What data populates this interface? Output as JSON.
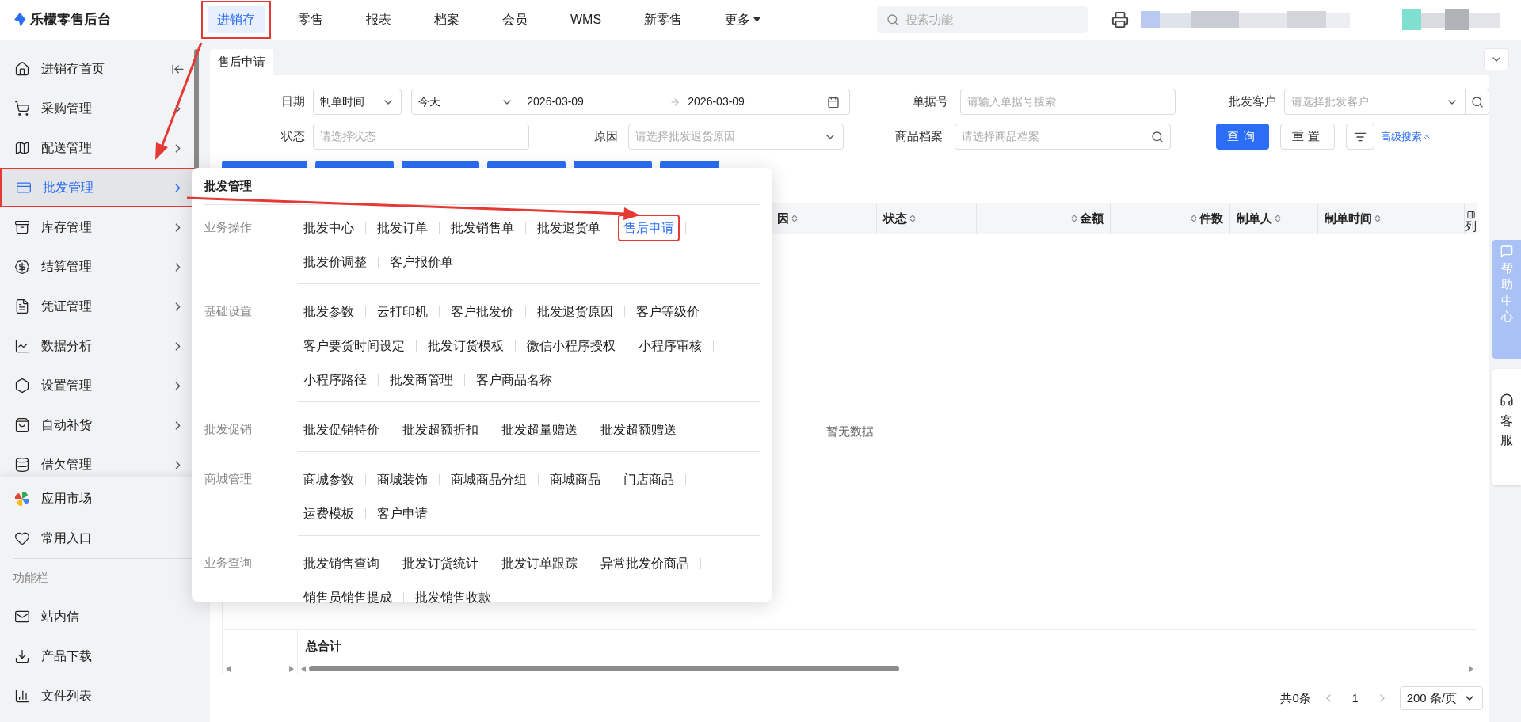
{
  "app": {
    "name": "乐檬零售后台"
  },
  "top_nav": [
    {
      "label": "进销存",
      "selected": true,
      "highlighted": true,
      "kind": "link"
    },
    {
      "label": "零售",
      "selected": false,
      "highlighted": false,
      "kind": "link"
    },
    {
      "label": "报表",
      "selected": false,
      "highlighted": false,
      "kind": "link"
    },
    {
      "label": "档案",
      "selected": false,
      "highlighted": false,
      "kind": "link"
    },
    {
      "label": "会员",
      "selected": false,
      "highlighted": false,
      "kind": "link"
    },
    {
      "label": "WMS",
      "selected": false,
      "highlighted": false,
      "kind": "link"
    },
    {
      "label": "新零售",
      "selected": false,
      "highlighted": false,
      "kind": "link"
    },
    {
      "label": "更多",
      "selected": false,
      "highlighted": false,
      "kind": "dropdown"
    }
  ],
  "search": {
    "placeholder": "搜索功能"
  },
  "sidebar": {
    "items": [
      {
        "label": "进销存首页",
        "kind": "home",
        "selected": false,
        "highlighted": false
      },
      {
        "label": "采购管理",
        "kind": "group",
        "selected": false,
        "highlighted": false
      },
      {
        "label": "配送管理",
        "kind": "group",
        "selected": false,
        "highlighted": false
      },
      {
        "label": "批发管理",
        "kind": "group",
        "selected": true,
        "highlighted": true
      },
      {
        "label": "库存管理",
        "kind": "group",
        "selected": false,
        "highlighted": false
      },
      {
        "label": "结算管理",
        "kind": "group",
        "selected": false,
        "highlighted": false
      },
      {
        "label": "凭证管理",
        "kind": "group",
        "selected": false,
        "highlighted": false
      },
      {
        "label": "数据分析",
        "kind": "group",
        "selected": false,
        "highlighted": false
      },
      {
        "label": "设置管理",
        "kind": "group",
        "selected": false,
        "highlighted": false
      },
      {
        "label": "自动补货",
        "kind": "group",
        "selected": false,
        "highlighted": false
      },
      {
        "label": "借欠管理",
        "kind": "group",
        "selected": false,
        "highlighted": false
      }
    ],
    "quick": [
      {
        "label": "应用市场"
      },
      {
        "label": "常用入口"
      }
    ],
    "section_title": "功能栏",
    "tools": [
      {
        "label": "站内信"
      },
      {
        "label": "产品下载"
      },
      {
        "label": "文件列表"
      }
    ]
  },
  "tabs": [
    {
      "label": "售后申请",
      "selected": true
    }
  ],
  "filters": {
    "date": {
      "label": "日期",
      "field": "制单时间",
      "preset": "今天",
      "start": "2026-03-09",
      "end": "2026-03-09"
    },
    "doc_no": {
      "label": "单据号",
      "placeholder": "请输入单据号搜索"
    },
    "customer": {
      "label": "批发客户",
      "placeholder": "请选择批发客户"
    },
    "status": {
      "label": "状态",
      "placeholder": "请选择状态"
    },
    "reason": {
      "label": "原因",
      "placeholder": "请选择批发退货原因"
    },
    "product": {
      "label": "商品档案",
      "placeholder": "请选择商品档案"
    },
    "buttons": [
      {
        "label": "查询",
        "kind": "primary"
      },
      {
        "label": "重置",
        "kind": "default"
      }
    ],
    "advanced_link": "高级搜索"
  },
  "popup": {
    "title": "批发管理",
    "sections": [
      {
        "label": "业务操作",
        "items": [
          {
            "label": "批发中心",
            "selected": false,
            "highlighted": false
          },
          {
            "label": "批发订单",
            "selected": false,
            "highlighted": false
          },
          {
            "label": "批发销售单",
            "selected": false,
            "highlighted": false
          },
          {
            "label": "批发退货单",
            "selected": false,
            "highlighted": false
          },
          {
            "label": "售后申请",
            "selected": true,
            "highlighted": true
          },
          {
            "label": "批发价调整",
            "selected": false,
            "highlighted": false
          },
          {
            "label": "客户报价单",
            "selected": false,
            "highlighted": false
          }
        ]
      },
      {
        "label": "基础设置",
        "items": [
          {
            "label": "批发参数",
            "selected": false,
            "highlighted": false
          },
          {
            "label": "云打印机",
            "selected": false,
            "highlighted": false
          },
          {
            "label": "客户批发价",
            "selected": false,
            "highlighted": false
          },
          {
            "label": "批发退货原因",
            "selected": false,
            "highlighted": false
          },
          {
            "label": "客户等级价",
            "selected": false,
            "highlighted": false
          },
          {
            "label": "客户要货时间设定",
            "selected": false,
            "highlighted": false
          },
          {
            "label": "批发订货模板",
            "selected": false,
            "highlighted": false
          },
          {
            "label": "微信小程序授权",
            "selected": false,
            "highlighted": false
          },
          {
            "label": "小程序审核",
            "selected": false,
            "highlighted": false
          },
          {
            "label": "小程序路径",
            "selected": false,
            "highlighted": false
          },
          {
            "label": "批发商管理",
            "selected": false,
            "highlighted": false
          },
          {
            "label": "客户商品名称",
            "selected": false,
            "highlighted": false
          }
        ]
      },
      {
        "label": "批发促销",
        "items": [
          {
            "label": "批发促销特价",
            "selected": false,
            "highlighted": false
          },
          {
            "label": "批发超额折扣",
            "selected": false,
            "highlighted": false
          },
          {
            "label": "批发超量赠送",
            "selected": false,
            "highlighted": false
          },
          {
            "label": "批发超额赠送",
            "selected": false,
            "highlighted": false
          }
        ]
      },
      {
        "label": "商城管理",
        "items": [
          {
            "label": "商城参数",
            "selected": false,
            "highlighted": false
          },
          {
            "label": "商城装饰",
            "selected": false,
            "highlighted": false
          },
          {
            "label": "商城商品分组",
            "selected": false,
            "highlighted": false
          },
          {
            "label": "商城商品",
            "selected": false,
            "highlighted": false
          },
          {
            "label": "门店商品",
            "selected": false,
            "highlighted": false
          },
          {
            "label": "运费模板",
            "selected": false,
            "highlighted": false
          },
          {
            "label": "客户申请",
            "selected": false,
            "highlighted": false
          }
        ]
      },
      {
        "label": "业务查询",
        "items": [
          {
            "label": "批发销售查询",
            "selected": false,
            "highlighted": false
          },
          {
            "label": "批发订货统计",
            "selected": false,
            "highlighted": false
          },
          {
            "label": "批发订单跟踪",
            "selected": false,
            "highlighted": false
          },
          {
            "label": "异常批发价商品",
            "selected": false,
            "highlighted": false
          },
          {
            "label": "销售员销售提成",
            "selected": false,
            "highlighted": false
          },
          {
            "label": "批发销售收款",
            "selected": false,
            "highlighted": false
          }
        ]
      }
    ]
  },
  "table": {
    "columns": [
      {
        "label": "因",
        "kind": "text"
      },
      {
        "label": "状态",
        "kind": "text"
      },
      {
        "label": "金额",
        "kind": "number"
      },
      {
        "label": "件数",
        "kind": "number"
      },
      {
        "label": "制单人",
        "kind": "text"
      },
      {
        "label": "制单时间",
        "kind": "text"
      }
    ],
    "column_settings": "列",
    "empty_text": "暂无数据",
    "total_label": "总合计"
  },
  "pagination": {
    "total": "共0条",
    "page": "1",
    "page_size": "200 条/页"
  },
  "help": {
    "help_center": "帮助中心",
    "service": "客服"
  }
}
